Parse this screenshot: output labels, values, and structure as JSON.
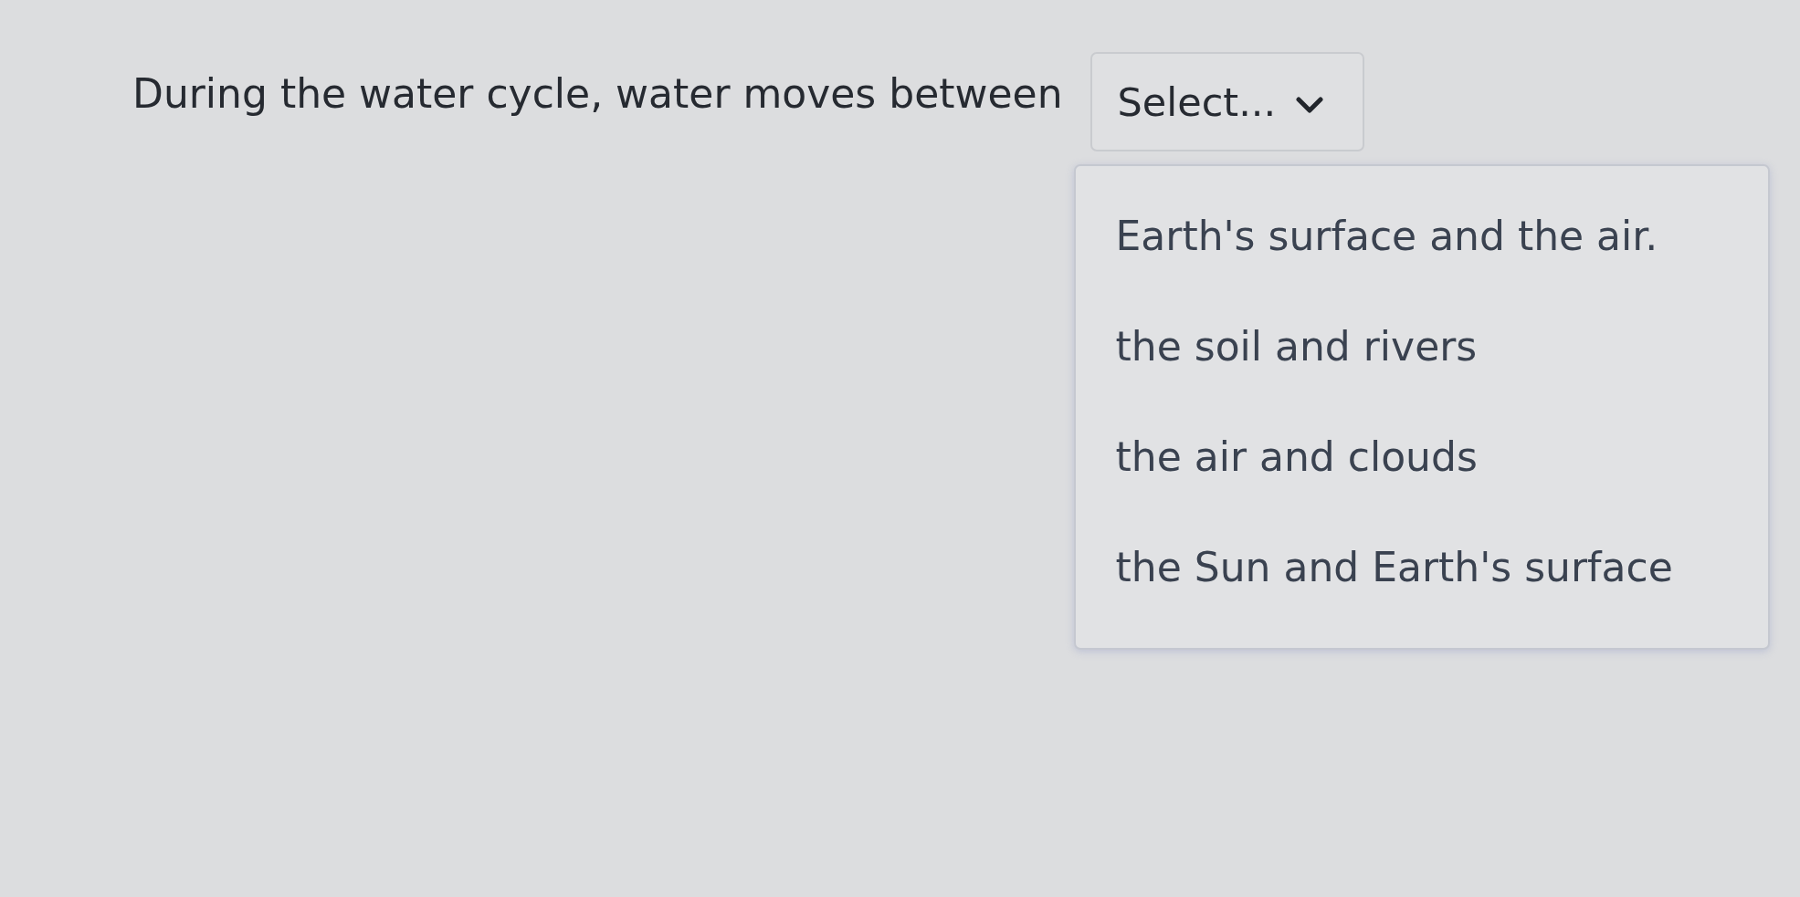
{
  "question": {
    "prompt": "During the water cycle, water moves between",
    "select": {
      "placeholder": "Select...",
      "expanded": true
    },
    "options": [
      {
        "label": "Earth's surface and the air."
      },
      {
        "label": "the soil and rivers"
      },
      {
        "label": "the air and clouds"
      },
      {
        "label": "the Sun and Earth's surface"
      }
    ]
  }
}
